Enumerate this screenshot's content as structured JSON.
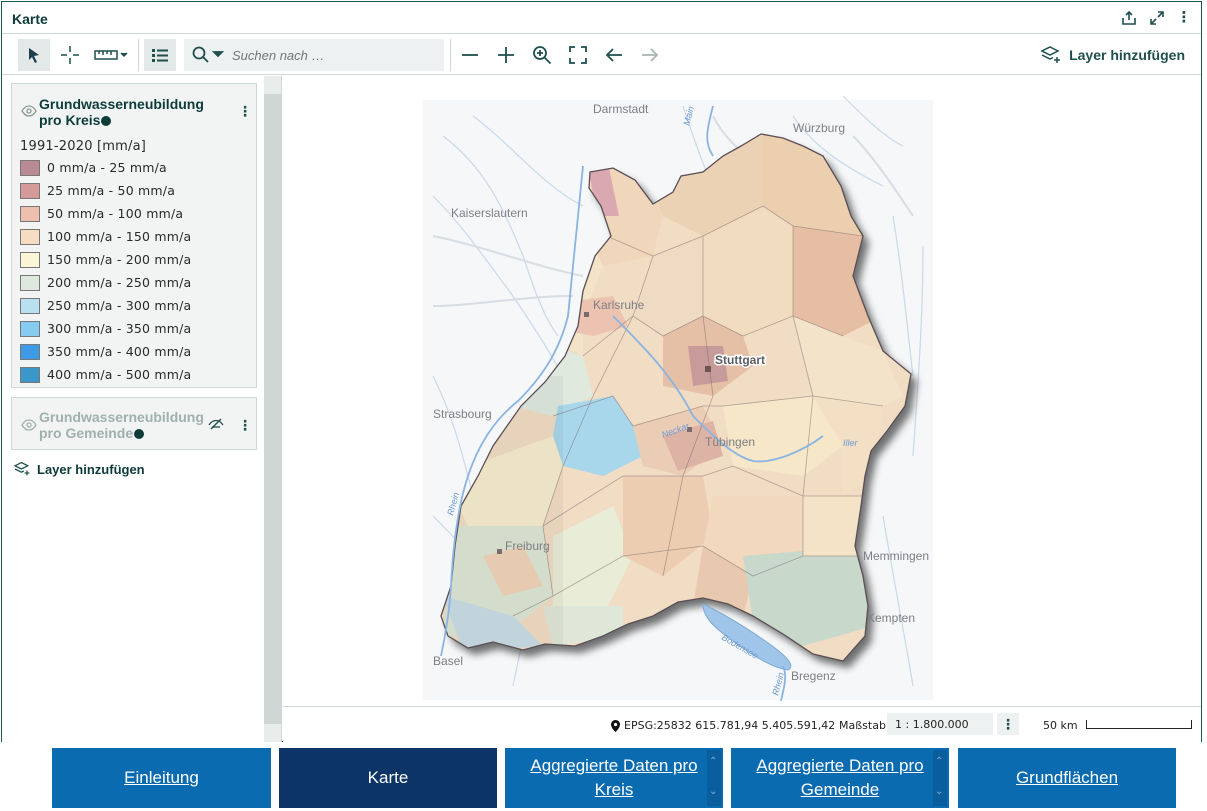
{
  "window": {
    "title": "Karte"
  },
  "toolbar": {
    "search_placeholder": "Suchen nach …",
    "add_layer_label": "Layer hinzufügen"
  },
  "sidebar": {
    "layers": [
      {
        "title": "Grundwasserneubildung pro Kreis",
        "legend_title": "1991-2020 [mm/a]",
        "legend": [
          {
            "label": "0 mm/a - 25 mm/a",
            "color": "#b98a96"
          },
          {
            "label": "25 mm/a - 50 mm/a",
            "color": "#d49a9a"
          },
          {
            "label": "50 mm/a - 100 mm/a",
            "color": "#ecbfae"
          },
          {
            "label": "100 mm/a - 150 mm/a",
            "color": "#f6dcc0"
          },
          {
            "label": "150 mm/a - 200 mm/a",
            "color": "#fbf5d8"
          },
          {
            "label": "200 mm/a - 250 mm/a",
            "color": "#dde9dc"
          },
          {
            "label": "250 mm/a - 300 mm/a",
            "color": "#b9e0ef"
          },
          {
            "label": "300 mm/a - 350 mm/a",
            "color": "#86ccf0"
          },
          {
            "label": "350 mm/a - 400 mm/a",
            "color": "#3f9ae8"
          },
          {
            "label": "400 mm/a - 500 mm/a",
            "color": "#3b97c9"
          }
        ]
      },
      {
        "title": "Grundwasserneubildung pro Gemeinde"
      }
    ],
    "add_layer_label": "Layer hinzufügen"
  },
  "map": {
    "places": {
      "darmstadt": "Darmstadt",
      "wuerzburg": "Würzburg",
      "kaiserslautern": "Kaiserslautern",
      "karlsruhe": "Karlsruhe",
      "stuttgart": "Stuttgart",
      "strasbourg": "Strasbourg",
      "tuebingen": "Tübingen",
      "freiburg": "Freiburg",
      "memmingen": "Memmingen",
      "kempten": "Kempten",
      "basel": "Basel",
      "bregenz": "Bregenz"
    },
    "water": {
      "main": "Main",
      "neckar": "Neckar",
      "rhein1": "Rhein",
      "rhein2": "Rhein",
      "bodensee": "Bodensee",
      "iller": "Iller"
    }
  },
  "status": {
    "coordinates": "EPSG:25832 615.781,94  5.405.591,42",
    "scale_label": "Maßstab",
    "scale_value": "1 : 1.800.000",
    "scalebar_label": "50 km"
  },
  "tabs": [
    {
      "label": "Einleitung"
    },
    {
      "label": "Karte"
    },
    {
      "label": "Aggregierte Daten pro Kreis"
    },
    {
      "label": "Aggregierte Daten pro Gemeinde"
    },
    {
      "label": "Grundflächen"
    }
  ]
}
